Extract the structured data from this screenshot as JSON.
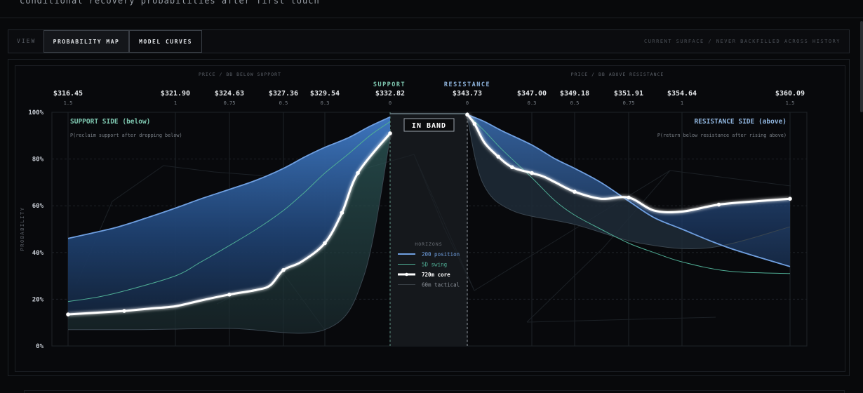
{
  "header": {
    "subtitle": "conditional recovery probabilities after first touch"
  },
  "toolbar": {
    "view_label": "VIEW",
    "tabs": [
      {
        "label": "PROBABILITY MAP",
        "active": true
      },
      {
        "label": "MODEL CURVES",
        "active": false
      }
    ],
    "note": "CURRENT SURFACE / NEVER BACKFILLED ACROSS HISTORY"
  },
  "colors": {
    "background": "#08090c",
    "support_accent": "#7ec7b0",
    "resistance_accent": "#8fb4dd",
    "series_200d": "#6f9fe0",
    "series_5d": "#4fae95",
    "series_720m": "#ffffff",
    "series_60m": "#3a4047"
  },
  "chart_data": {
    "type": "line",
    "top_caption_left": "PRICE / BB BELOW SUPPORT",
    "top_caption_right": "PRICE / BB ABOVE RESISTANCE",
    "ylabel": "PROBABILITY",
    "ylim": [
      0,
      100
    ],
    "y_ticks": [
      "0%",
      "20%",
      "40%",
      "60%",
      "80%",
      "100%"
    ],
    "support_label": "SUPPORT",
    "resistance_label": "RESISTANCE",
    "band_label": "IN BAND",
    "support_side": {
      "title": "SUPPORT SIDE (below)",
      "subtitle": "P(reclaim support after dropping below)",
      "prices": [
        {
          "price": "$316.45",
          "bb": "1.5"
        },
        {
          "price": "$321.90",
          "bb": "1"
        },
        {
          "price": "$324.63",
          "bb": "0.75"
        },
        {
          "price": "$327.36",
          "bb": "0.5"
        },
        {
          "price": "$329.54",
          "bb": "0.3"
        },
        {
          "price": "$332.82",
          "bb": "0"
        }
      ]
    },
    "resistance_side": {
      "title": "RESISTANCE SIDE (above)",
      "subtitle": "P(return below resistance after rising above)",
      "prices": [
        {
          "price": "$343.73",
          "bb": "0"
        },
        {
          "price": "$347.00",
          "bb": "0.3"
        },
        {
          "price": "$349.18",
          "bb": "0.5"
        },
        {
          "price": "$351.91",
          "bb": "0.75"
        },
        {
          "price": "$354.64",
          "bb": "1"
        },
        {
          "price": "$360.09",
          "bb": "1.5"
        }
      ]
    },
    "legend": {
      "title": "HORIZONS",
      "items": [
        {
          "name": "200 position",
          "color": "#6f9fe0"
        },
        {
          "name": "5D swing",
          "color": "#4fae95"
        },
        {
          "name": "720m core",
          "color": "#ffffff"
        },
        {
          "name": "60m tactical",
          "color": "#3a4047"
        }
      ]
    },
    "series": [
      {
        "name": "200 position",
        "support": [
          [
            316.45,
            46
          ],
          [
            317.5,
            48
          ],
          [
            319,
            51
          ],
          [
            320.5,
            55
          ],
          [
            321.9,
            59
          ],
          [
            323.2,
            63
          ],
          [
            324.63,
            67
          ],
          [
            326,
            71
          ],
          [
            327.36,
            76
          ],
          [
            328.5,
            81
          ],
          [
            329.54,
            85
          ],
          [
            330.7,
            89
          ],
          [
            331.8,
            94
          ],
          [
            332.82,
            98
          ]
        ],
        "resistance": [
          [
            343.73,
            99
          ],
          [
            344.6,
            96
          ],
          [
            345.5,
            92
          ],
          [
            347.0,
            86
          ],
          [
            348.2,
            80
          ],
          [
            349.18,
            76
          ],
          [
            350.5,
            70
          ],
          [
            351.91,
            62
          ],
          [
            353.2,
            55
          ],
          [
            354.64,
            50
          ],
          [
            357.0,
            42
          ],
          [
            360.09,
            34
          ]
        ]
      },
      {
        "name": "5D swing",
        "support": [
          [
            316.45,
            19
          ],
          [
            318,
            21
          ],
          [
            319.5,
            24
          ],
          [
            321.9,
            30
          ],
          [
            323.2,
            36
          ],
          [
            324.63,
            43
          ],
          [
            326,
            50
          ],
          [
            327.36,
            58
          ],
          [
            328.5,
            66
          ],
          [
            329.54,
            74
          ],
          [
            330.7,
            82
          ],
          [
            331.8,
            90
          ],
          [
            332.82,
            96
          ]
        ],
        "resistance": [
          [
            343.73,
            99
          ],
          [
            344.6,
            92
          ],
          [
            345.5,
            84
          ],
          [
            347.0,
            72
          ],
          [
            348.2,
            62
          ],
          [
            349.18,
            56
          ],
          [
            350.5,
            50
          ],
          [
            351.91,
            44
          ],
          [
            353.2,
            40
          ],
          [
            354.64,
            36
          ],
          [
            357.0,
            32
          ],
          [
            360.09,
            31
          ]
        ]
      },
      {
        "name": "720m core",
        "support": [
          [
            316.45,
            13.5
          ],
          [
            317.8,
            14.2
          ],
          [
            319.3,
            15
          ],
          [
            320.6,
            16
          ],
          [
            321.9,
            17
          ],
          [
            323.2,
            19.5
          ],
          [
            324.63,
            22
          ],
          [
            326,
            24
          ],
          [
            326.7,
            26
          ],
          [
            327.36,
            32.5
          ],
          [
            328.3,
            36
          ],
          [
            329.54,
            44
          ],
          [
            330.4,
            57
          ],
          [
            331.2,
            74
          ],
          [
            332.82,
            91
          ]
        ],
        "resistance": [
          [
            343.73,
            99
          ],
          [
            344.1,
            95
          ],
          [
            344.6,
            87
          ],
          [
            345.3,
            81
          ],
          [
            346.0,
            76.5
          ],
          [
            347.0,
            74
          ],
          [
            347.6,
            72.5
          ],
          [
            348.2,
            70
          ],
          [
            349.18,
            66
          ],
          [
            350.5,
            63
          ],
          [
            351.91,
            63.5
          ],
          [
            353.2,
            58
          ],
          [
            354.64,
            57.5
          ],
          [
            356.5,
            60.5
          ],
          [
            358.5,
            62
          ],
          [
            360.09,
            63
          ]
        ]
      },
      {
        "name": "60m tactical",
        "band_low_support": [
          [
            316.45,
            7
          ],
          [
            320,
            7
          ],
          [
            324.63,
            7.5
          ],
          [
            329.54,
            7
          ],
          [
            331.5,
            30
          ],
          [
            332.82,
            89
          ]
        ],
        "band_low_resistance": [
          [
            343.73,
            98
          ],
          [
            344.5,
            70
          ],
          [
            346.0,
            58
          ],
          [
            349.18,
            52
          ],
          [
            352.5,
            44
          ],
          [
            356.0,
            42
          ],
          [
            360.09,
            51
          ]
        ]
      }
    ]
  }
}
